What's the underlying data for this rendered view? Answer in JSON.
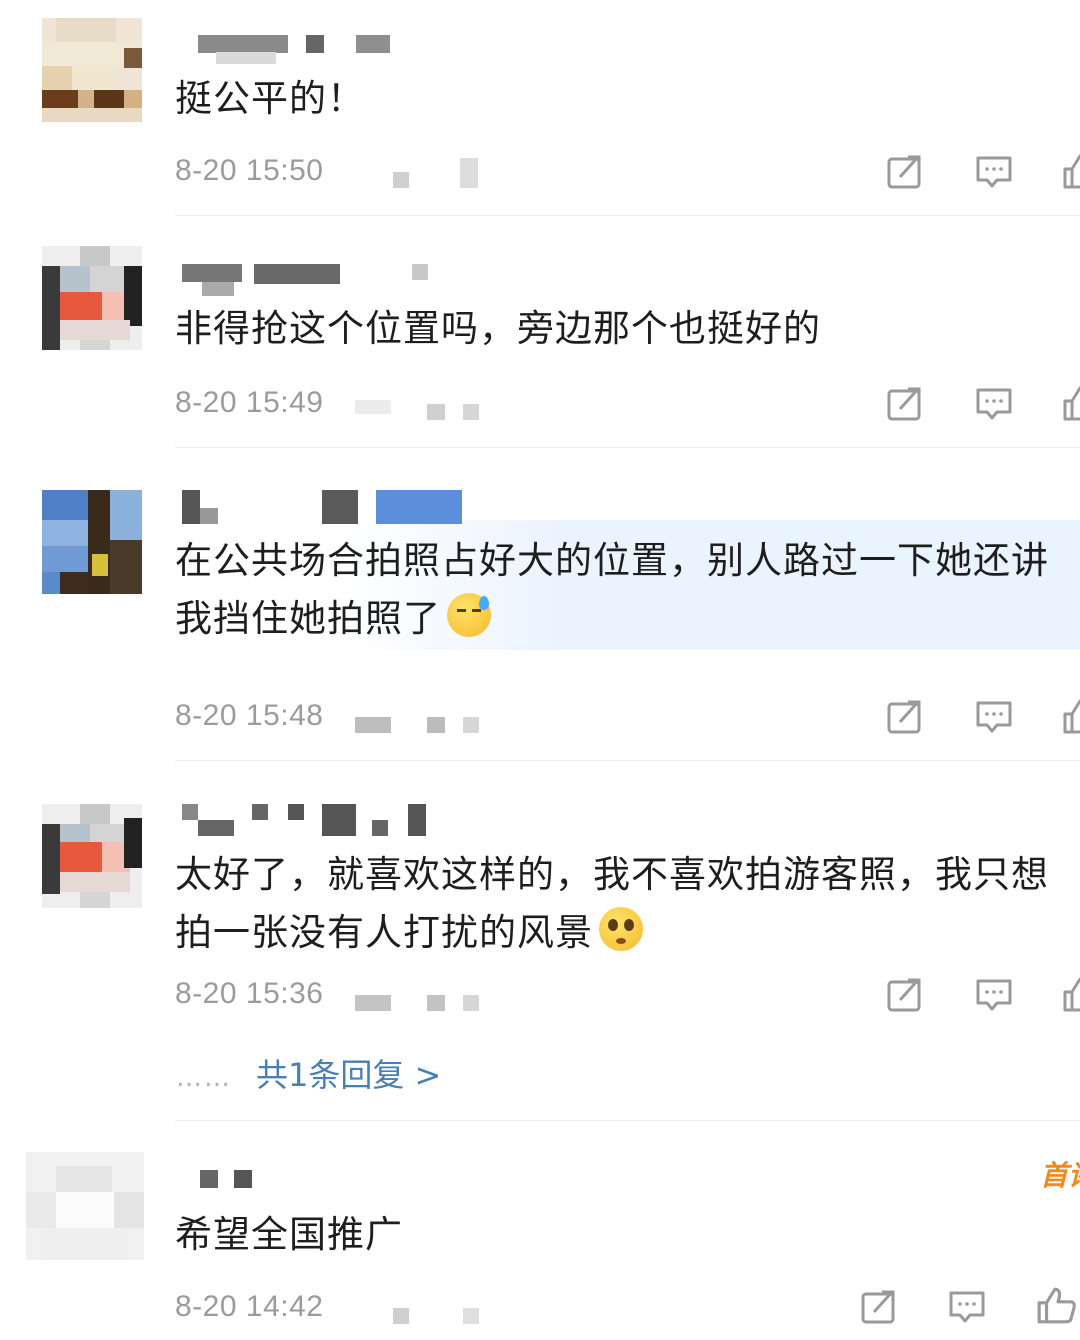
{
  "comments": [
    {
      "text": "挺公平的！",
      "time": "8-20 15:50"
    },
    {
      "text": "非得抢这个位置吗，旁边那个也挺好的",
      "time": "8-20 15:49"
    },
    {
      "text_line1": "在公共场合拍照占好大的位置，别人路过一下她还讲",
      "text_line2": "我挡住她拍照了",
      "time": "8-20 15:48"
    },
    {
      "text_line1": "太好了，就喜欢这样的，我不喜欢拍游客照，我只想",
      "text_line2": "拍一张没有人打扰的风景",
      "time": "8-20 15:36",
      "reply_link": "共1条回复 >",
      "reply_dots": "……"
    },
    {
      "text": "希望全国推广",
      "time": "8-20 14:42",
      "badge": "首评"
    }
  ],
  "icons": {
    "share": "share-icon",
    "comment": "comment-icon",
    "like": "thumbs-up-icon",
    "emoji_sweat": "sweat-smile-emoji",
    "emoji_plead": "pleading-face-emoji"
  },
  "colors": {
    "text": "#1e1e1e",
    "meta": "#9b9b9b",
    "link": "#4a7fb6",
    "badge": "#f08a1c",
    "icon": "#9a9a9a"
  }
}
